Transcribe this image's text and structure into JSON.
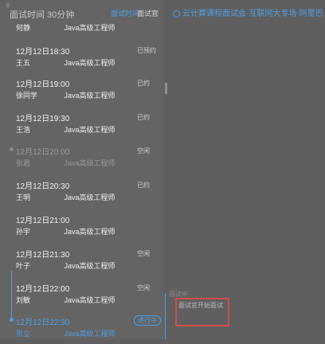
{
  "panel": {
    "title": "面试时间 30分钟",
    "tabs": [
      "面试时间",
      "面试官"
    ]
  },
  "slots": [
    {
      "time": "12月12日18:00",
      "name": "何静",
      "position": "Java高级工程师",
      "status": ""
    },
    {
      "time": "12月12日18:30",
      "name": "王五",
      "position": "Java高级工程师",
      "status": "已预约"
    },
    {
      "time": "12月12日19:00",
      "name": "徐同学",
      "position": "Java高级工程师",
      "status": "已约"
    },
    {
      "time": "12月12日19:30",
      "name": "王浩",
      "position": "Java高级工程师",
      "status": "已约"
    },
    {
      "time": "12月12日20:00",
      "name": "张君",
      "position": "Java高级工程师",
      "status": "空闲"
    },
    {
      "time": "12月12日20:30",
      "name": "王明",
      "position": "Java高级工程师",
      "status": "已约"
    },
    {
      "time": "12月12日21:00",
      "name": "孙宇",
      "position": "Java高级工程师",
      "status": ""
    },
    {
      "time": "12月12日21:30",
      "name": "叶子",
      "position": "Java高级工程师",
      "status": "空闲"
    },
    {
      "time": "12月12日22:00",
      "name": "刘敏",
      "position": "Java高级工程师",
      "status": "空闲"
    },
    {
      "time": "12月12日22:30",
      "name": "张立",
      "position": "Java高级工程师",
      "status": "进行中"
    }
  ],
  "right": {
    "headline": "云计算课程面试会·互联网大专场·阿里巴巴面试",
    "snippet": "面试中",
    "highlight_text": "面试官开始面试"
  },
  "colors": {
    "accent": "#4f9ee3",
    "highlight_border": "#d24c4c"
  }
}
